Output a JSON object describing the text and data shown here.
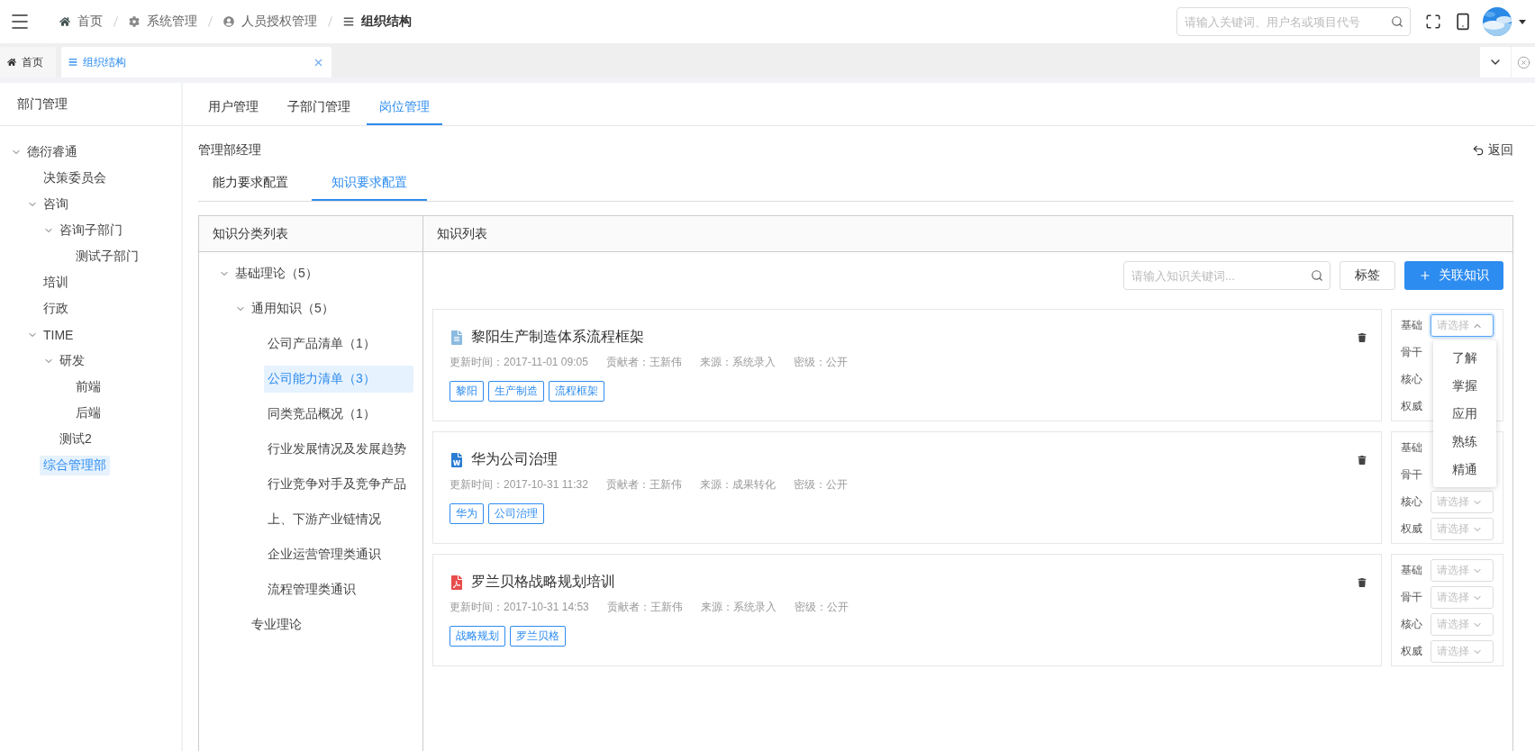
{
  "header": {
    "breadcrumb": [
      {
        "label": "首页",
        "current": false
      },
      {
        "label": "系统管理",
        "current": false
      },
      {
        "label": "人员授权管理",
        "current": false
      },
      {
        "label": "组织结构",
        "current": true
      }
    ],
    "search": {
      "placeholder": "请输入关键词、用户名或项目代号"
    }
  },
  "page_tabs": [
    {
      "label": "首页",
      "selected": false,
      "closable": false
    },
    {
      "label": "组织结构",
      "selected": true,
      "closable": true
    }
  ],
  "sidebar": {
    "title": "部门管理",
    "tree": [
      {
        "label": "德衍睿通",
        "expanded": true,
        "selected": false,
        "children": [
          {
            "label": "决策委员会",
            "selected": false
          },
          {
            "label": "咨询",
            "expanded": true,
            "selected": false,
            "children": [
              {
                "label": "咨询子部门",
                "expanded": true,
                "selected": false,
                "children": [
                  {
                    "label": "测试子部门",
                    "selected": false
                  }
                ]
              }
            ]
          },
          {
            "label": "培训",
            "selected": false
          },
          {
            "label": "行政",
            "selected": false
          },
          {
            "label": "TIME",
            "expanded": true,
            "selected": false,
            "children": [
              {
                "label": "研发",
                "expanded": true,
                "selected": false,
                "children": [
                  {
                    "label": "前端",
                    "selected": false
                  },
                  {
                    "label": "后端",
                    "selected": false
                  }
                ]
              },
              {
                "label": "测试2",
                "selected": false
              }
            ]
          },
          {
            "label": "综合管理部",
            "selected": true
          }
        ]
      }
    ]
  },
  "main_tabs": [
    {
      "label": "用户管理",
      "selected": false
    },
    {
      "label": "子部门管理",
      "selected": false
    },
    {
      "label": "岗位管理",
      "selected": true
    }
  ],
  "position_title": "管理部经理",
  "back": "返回",
  "sub_tabs": [
    {
      "label": "能力要求配置",
      "selected": false
    },
    {
      "label": "知识要求配置",
      "selected": true
    }
  ],
  "category_panel": {
    "title": "知识分类列表",
    "tree": [
      {
        "label": "基础理论（5）",
        "expanded": true,
        "selected": false,
        "children": [
          {
            "label": "通用知识（5）",
            "expanded": true,
            "selected": false,
            "children": [
              {
                "label": "公司产品清单（1）",
                "selected": false
              },
              {
                "label": "公司能力清单（3）",
                "selected": true
              },
              {
                "label": "同类竞品概况（1）",
                "selected": false
              },
              {
                "label": "行业发展情况及发展趋势",
                "selected": false
              },
              {
                "label": "行业竞争对手及竞争产品",
                "selected": false
              },
              {
                "label": "上、下游产业链情况",
                "selected": false
              },
              {
                "label": "企业运营管理类通识",
                "selected": false
              },
              {
                "label": "流程管理类通识",
                "selected": false
              }
            ]
          },
          {
            "label": "专业理论",
            "selected": false
          }
        ]
      }
    ]
  },
  "knowledge_panel": {
    "title": "知识列表",
    "search": {
      "placeholder": "请输入知识关键词..."
    },
    "tag_button": "标签",
    "link_button": "关联知识",
    "items": [
      {
        "kind": "doc",
        "title": "黎阳生产制造体系流程框架",
        "meta": [
          "更新时间：2017-11-01 09:05",
          "贡献者：王新伟",
          "来源：系统录入",
          "密级：公开"
        ],
        "tags": [
          "黎阳",
          "生产制造",
          "流程框架"
        ],
        "levels": [
          {
            "label": "基础",
            "placeholder": "请选择",
            "open": true
          },
          {
            "label": "骨干"
          },
          {
            "label": "核心"
          },
          {
            "label": "权威"
          }
        ]
      },
      {
        "kind": "word",
        "title": "华为公司治理",
        "meta": [
          "更新时间：2017-10-31 11:32",
          "贡献者：王新伟",
          "来源：成果转化",
          "密级：公开"
        ],
        "tags": [
          "华为",
          "公司治理"
        ],
        "levels": [
          {
            "label": "基础"
          },
          {
            "label": "骨干"
          },
          {
            "label": "核心",
            "placeholder": "请选择",
            "open": false
          },
          {
            "label": "权威",
            "placeholder": "请选择",
            "open": false
          }
        ]
      },
      {
        "kind": "pdf",
        "title": "罗兰贝格战略规划培训",
        "meta": [
          "更新时间：2017-10-31 14:53",
          "贡献者：王新伟",
          "来源：系统录入",
          "密级：公开"
        ],
        "tags": [
          "战略规划",
          "罗兰贝格"
        ],
        "levels": [
          {
            "label": "基础",
            "placeholder": "请选择",
            "open": false
          },
          {
            "label": "骨干",
            "placeholder": "请选择",
            "open": false
          },
          {
            "label": "核心",
            "placeholder": "请选择",
            "open": false
          },
          {
            "label": "权威",
            "placeholder": "请选择",
            "open": false
          }
        ]
      }
    ]
  },
  "level_options": [
    "了解",
    "掌握",
    "应用",
    "熟练",
    "精通"
  ]
}
